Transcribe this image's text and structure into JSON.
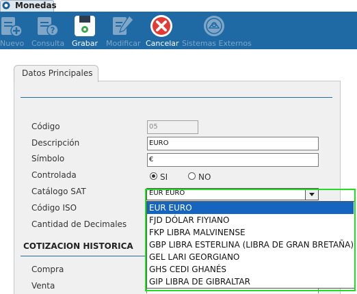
{
  "window": {
    "tab_title": "Monedas"
  },
  "toolbar": {
    "buttons": [
      {
        "label": "Nuevo",
        "icon": "new-document-icon",
        "enabled": false
      },
      {
        "label": "Consulta",
        "icon": "query-document-icon",
        "enabled": false
      },
      {
        "label": "Grabar",
        "icon": "save-floppy-icon",
        "enabled": true
      },
      {
        "label": "Modificar",
        "icon": "edit-pencil-icon",
        "enabled": false
      },
      {
        "label": "Cancelar",
        "icon": "cancel-x-icon",
        "enabled": true
      },
      {
        "label": "Sistemas Externos",
        "icon": "external-systems-icon",
        "enabled": false
      }
    ]
  },
  "panel": {
    "tab_label": "Datos Principales",
    "fields": {
      "codigo": {
        "label": "Código",
        "value": "05"
      },
      "descripcion": {
        "label": "Descripción",
        "value": "EURO"
      },
      "simbolo": {
        "label": "Símbolo",
        "value": "€"
      },
      "controlada": {
        "label": "Controlada",
        "options": [
          "SI",
          "NO"
        ],
        "selected": "SI"
      },
      "catalogo_sat": {
        "label": "Catálogo SAT",
        "value": "EUR  EURO"
      },
      "codigo_iso": {
        "label": "Código ISO"
      },
      "cantidad_decimales": {
        "label": "Cantidad de Decimales"
      }
    },
    "section_heading": "COTIZACION HISTORICA",
    "cotizacion": {
      "compra_label": "Compra",
      "venta_label": "Venta"
    }
  },
  "dropdown": {
    "options": [
      "EUR  EURO",
      "FJD  DÓLAR FIYIANO",
      "FKP  LIBRA MALVINENSE",
      "GBP  LIBRA ESTERLINA (LIBRA DE GRAN BRETAÑA)",
      "GEL  LARI GEORGIANO",
      "GHS  CEDI GHANÉS",
      "GIP  LIBRA DE GIBRALTAR"
    ],
    "selected_index": 0
  },
  "colors": {
    "toolbar_bg": "#1f6aa5",
    "selection": "#1565c0",
    "highlight": "#22dd22",
    "cancel_red": "#e53935"
  }
}
